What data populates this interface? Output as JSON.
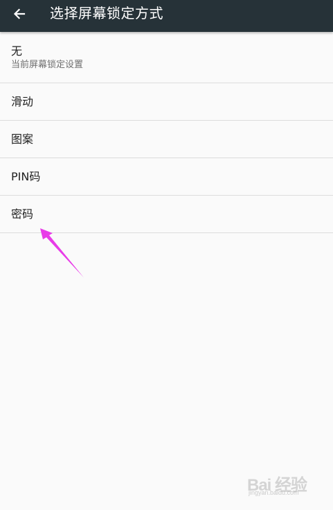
{
  "app_bar": {
    "title": "选择屏幕锁定方式",
    "back_icon": "arrow-left-icon",
    "background": "#263238"
  },
  "list": {
    "items": [
      {
        "title": "无",
        "subtitle": "当前屏幕锁定设置"
      },
      {
        "title": "滑动"
      },
      {
        "title": "图案"
      },
      {
        "title": "PIN码"
      },
      {
        "title": "密码"
      }
    ]
  },
  "annotation": {
    "color": "#e83ce8",
    "icon": "annotation-arrow-icon"
  },
  "watermark": {
    "logo_text": "Bai 经验",
    "sub_text": "jingyan.baidu.com"
  }
}
